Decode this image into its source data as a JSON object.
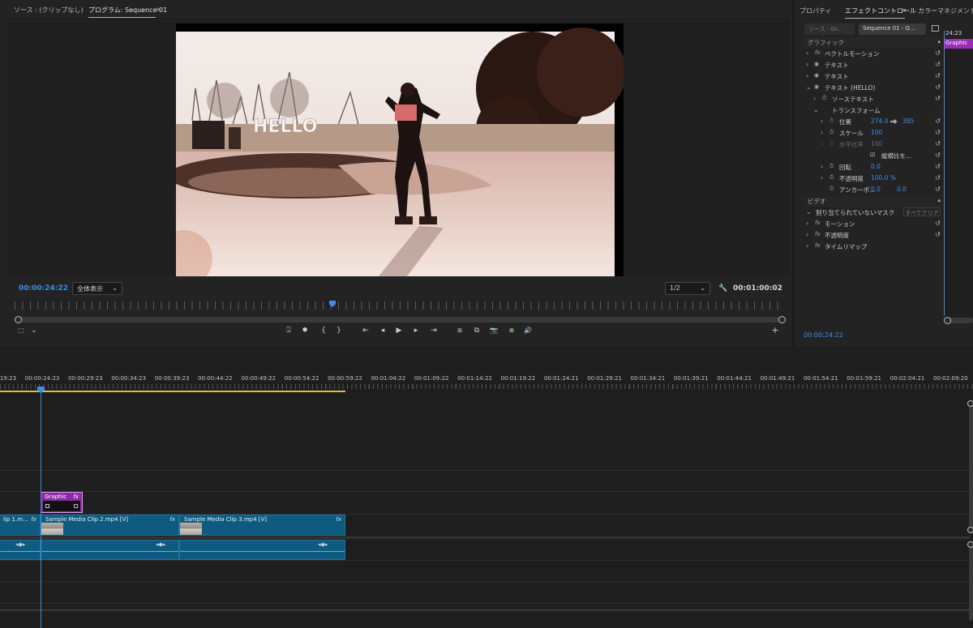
{
  "program_tabs": {
    "source": "ソース : (クリップなし)",
    "program": "プログラム: Sequence 01",
    "menu": "≡"
  },
  "monitor": {
    "timecode_current": "00:00:24:22",
    "fit_value": "全体表示",
    "resolution_value": "1/2",
    "timecode_duration": "00:01:00:02",
    "video_text": "HELLO"
  },
  "transport": {
    "mark_in_icon": "marker-lift-icon",
    "buttons": [
      "⍗",
      "⬢",
      "{",
      "}",
      "⇤",
      "◂",
      "▶",
      "▸",
      "⇥",
      "⧈",
      "⧉",
      "📷",
      "⧆",
      "🔊"
    ],
    "add": "+"
  },
  "effect_tabs": {
    "properties": "プロパティ",
    "effect_controls": "エフェクトコントロール",
    "menu": "≡",
    "color": "カラーマネジメント"
  },
  "effect_controls": {
    "source_a": "ソース - Gr...",
    "source_b": "Sequence 01 - G...",
    "ruler_time": "24:23",
    "graphic_bar": "Graphic",
    "section_graphic": "グラフィック",
    "vector_motion": "ベクトルモーション",
    "text1": "テキスト",
    "text2": "テキスト",
    "text_hello": "テキスト (HELLO)",
    "source_text": "ソーステキスト",
    "transform": "トランスフォーム",
    "position": "位置",
    "position_x": "274.0",
    "position_y": "385",
    "scale": "スケール",
    "scale_value": "100",
    "hscale": "水平比率",
    "hscale_value": "100",
    "uniform": "縦横比を...",
    "rotation": "回転",
    "rotation_value": "0.0",
    "opacity": "不透明度",
    "opacity_value": "100.0 %",
    "anchor": "アンカーポ...",
    "anchor_x": "0.0",
    "anchor_y": "0.0",
    "section_video": "ビデオ",
    "unassigned_mask": "割り当てられていないマスク",
    "clear_all": "すべてクリア",
    "motion": "モーション",
    "opacity2": "不透明度",
    "timeremap": "タイムリマップ",
    "time": "00:00:24:22"
  },
  "timeline": {
    "ruler_labels": [
      "19:23",
      "00:00:24:23",
      "00:00:29:23",
      "00:00:34:23",
      "00:00:39:23",
      "00:00:44:22",
      "00:00:49:22",
      "00:00:54:22",
      "00:00:59:22",
      "00:01:04:22",
      "00:01:09:22",
      "00:01:14:22",
      "00:01:19:22",
      "00:01:24:21",
      "00:01:29:21",
      "00:01:34:21",
      "00:01:39:21",
      "00:01:44:21",
      "00:01:49:21",
      "00:01:54:21",
      "00:01:59:21",
      "00:02:04:21",
      "00:02:09:20"
    ],
    "graphic_clip": {
      "name": "Graphic",
      "fx": "fx"
    },
    "clips": [
      {
        "name": "lip 1.m...",
        "fx": "fx"
      },
      {
        "name": "Sample Media Clip 2.mp4 [V]",
        "fx": "fx"
      },
      {
        "name": "Sample Media Clip 3.mp4 [V]",
        "fx": "fx"
      }
    ],
    "audio_kf": "◂◆▸"
  },
  "colors": {
    "accent": "#3f8ce8",
    "clip": "#0f5a7f",
    "graphic": "#8d2aa6",
    "work_area": "#d4c43a"
  }
}
